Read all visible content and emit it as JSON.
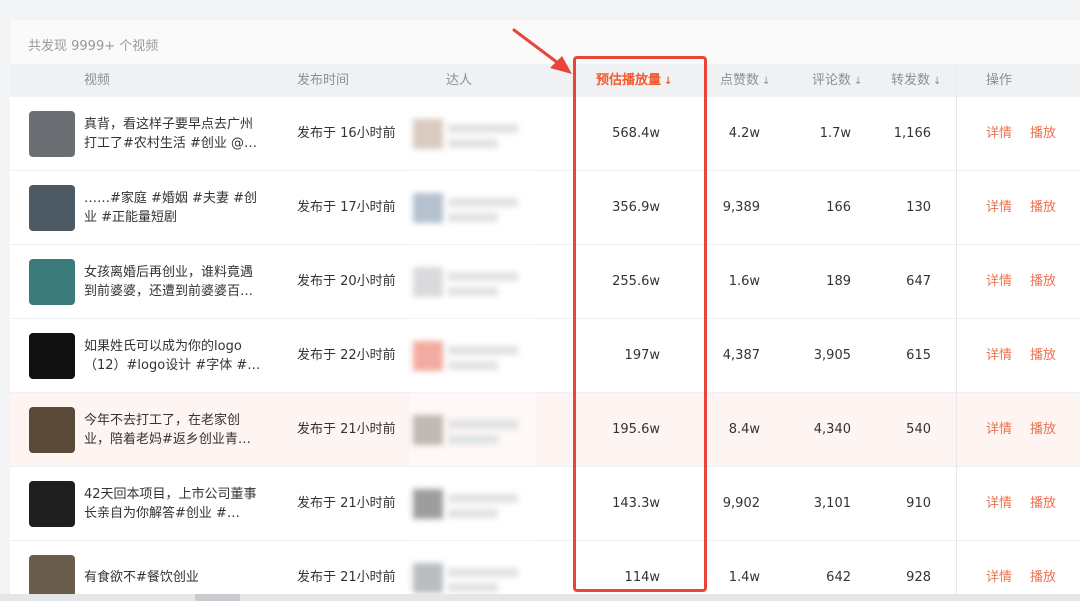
{
  "summary": "共发现 9999+ 个视频",
  "columns": {
    "video": "视频",
    "publish_time": "发布时间",
    "author": "达人",
    "est_views": "预估播放量",
    "likes": "点赞数",
    "comments": "评论数",
    "shares": "转发数",
    "actions": "操作"
  },
  "sort_icon": "↓",
  "actions": {
    "detail": "详情",
    "play": "播放"
  },
  "rows": [
    {
      "title": "真背，看这样子要早点去广州打工了#农村生活 #创业 @…",
      "time": "发布于 16小时前",
      "views": "568.4w",
      "likes": "4.2w",
      "comments": "1.7w",
      "shares": "1,166",
      "thumb_color": "#6b6e72",
      "avatar_color": "#b89a86"
    },
    {
      "title": "……#家庭 #婚姻 #夫妻 #创业 #正能量短剧",
      "time": "发布于 17小时前",
      "views": "356.9w",
      "likes": "9,389",
      "comments": "166",
      "shares": "130",
      "thumb_color": "#4d5a63",
      "avatar_color": "#6f8aa0"
    },
    {
      "title": "女孩离婚后再创业，谁料竟遇到前婆婆，还遭到前婆婆百…",
      "time": "发布于 20小时前",
      "views": "255.6w",
      "likes": "1.6w",
      "comments": "189",
      "shares": "647",
      "thumb_color": "#3d7a7a",
      "avatar_color": "#b7b9bd"
    },
    {
      "title": "如果姓氏可以成为你的logo（12）#logo设计 #字体 #…",
      "time": "发布于 22小时前",
      "views": "197w",
      "likes": "4,387",
      "comments": "3,905",
      "shares": "615",
      "thumb_color": "#111111",
      "avatar_color": "#e8604a"
    },
    {
      "title": "今年不去打工了，在老家创业，陪着老妈#返乡创业青…",
      "time": "发布于 21小时前",
      "views": "195.6w",
      "likes": "8.4w",
      "comments": "4,340",
      "shares": "540",
      "thumb_color": "#5a4a3a",
      "avatar_color": "#8a7a70"
    },
    {
      "title": "42天回本项目，上市公司董事长亲自为你解答#创业 #…",
      "time": "发布于 21小时前",
      "views": "143.3w",
      "likes": "9,902",
      "comments": "3,101",
      "shares": "910",
      "thumb_color": "#1e1e1e",
      "avatar_color": "#444444"
    },
    {
      "title": "有食欲不#餐饮创业",
      "time": "发布于 21小时前",
      "views": "114w",
      "likes": "1.4w",
      "comments": "642",
      "shares": "928",
      "thumb_color": "#6a5c4c",
      "avatar_color": "#7a8088"
    }
  ]
}
